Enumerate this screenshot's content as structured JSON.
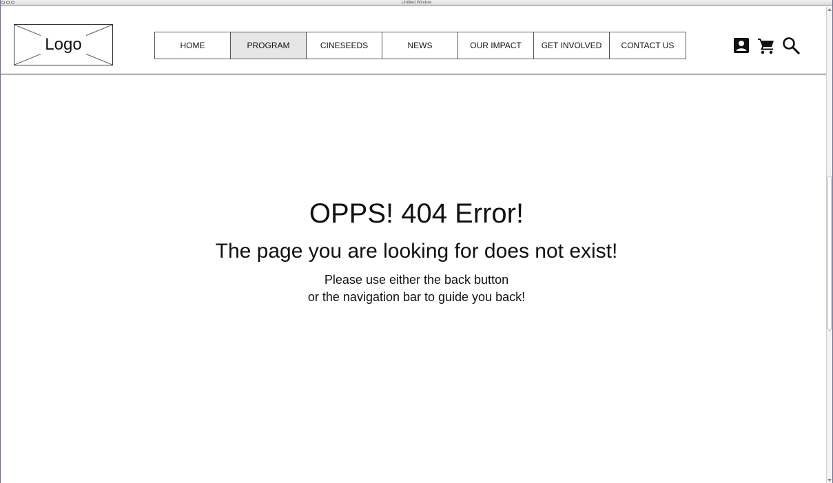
{
  "window": {
    "title": "Untitled Window"
  },
  "header": {
    "logo_text": "Logo",
    "nav": [
      {
        "label": "HOME",
        "active": false
      },
      {
        "label": "PROGRAM",
        "active": true
      },
      {
        "label": "CINESEEDS",
        "active": false
      },
      {
        "label": "NEWS",
        "active": false
      },
      {
        "label": "OUR IMPACT",
        "active": false
      },
      {
        "label": "GET INVOLVED",
        "active": false
      },
      {
        "label": "CONTACT US",
        "active": false
      }
    ],
    "icons": [
      "account-icon",
      "cart-icon",
      "search-icon"
    ]
  },
  "main": {
    "title": "OPPS! 404 Error!",
    "subtitle": "The page you are looking for does not exist!",
    "message_line1": "Please use either the back button",
    "message_line2": "or the navigation bar to guide you back!"
  },
  "colors": {
    "text": "#111111",
    "active_nav_bg": "#e6e6e6",
    "border": "#555555"
  }
}
